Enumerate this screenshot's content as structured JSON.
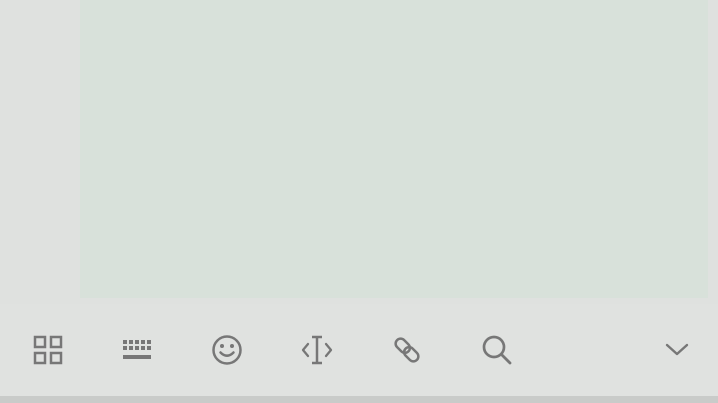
{
  "keyboard": {
    "toolbar": {
      "items": [
        {
          "name": "apps",
          "icon": "grid-icon"
        },
        {
          "name": "keyboard",
          "icon": "keyboard-icon"
        },
        {
          "name": "emoji",
          "icon": "smiley-icon"
        },
        {
          "name": "text-edit",
          "icon": "text-cursor-icon"
        },
        {
          "name": "clipboard",
          "icon": "link-icon"
        },
        {
          "name": "search",
          "icon": "search-icon"
        },
        {
          "name": "collapse",
          "icon": "chevron-down-icon"
        }
      ]
    }
  },
  "colors": {
    "background": "#dfe1df",
    "text_area": "#d8e1da",
    "icon": "#777777",
    "bottom_strip": "#c9cbc9"
  }
}
